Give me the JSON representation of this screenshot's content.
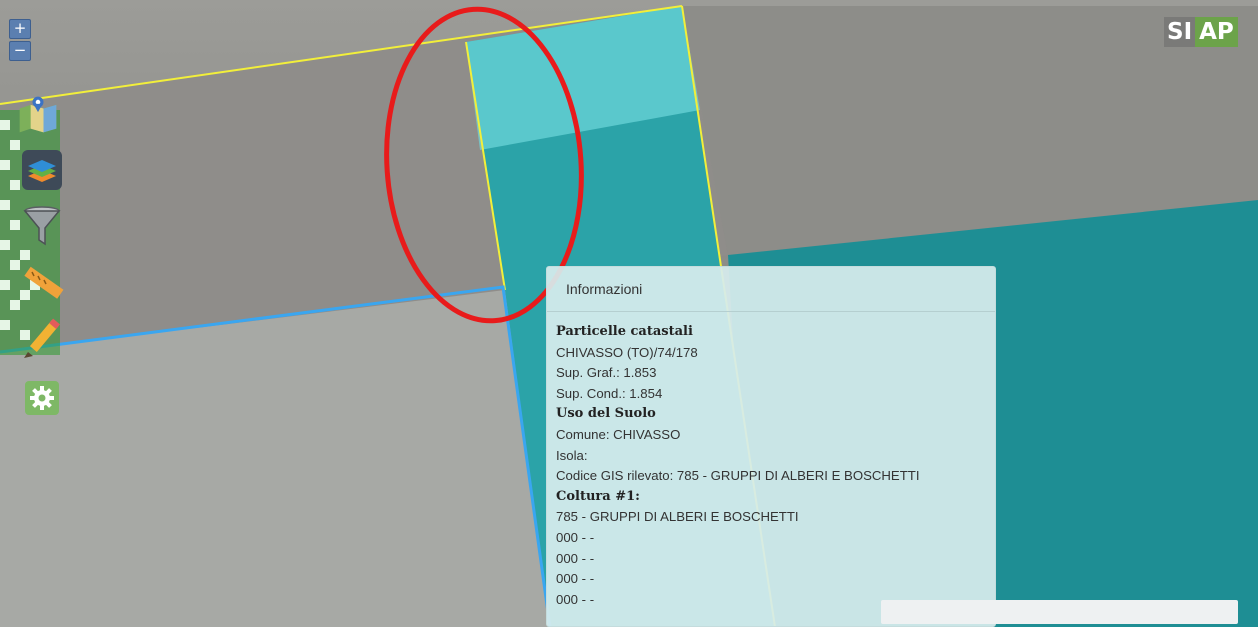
{
  "map": {
    "zoom_in_label": "+",
    "zoom_out_label": "−",
    "colors": {
      "parcel_teal": "#1f8f95",
      "parcel_border_yellow": "#f2ef3a",
      "parcel_border_blue": "#3aa6f0",
      "annotation_red": "#e81b1b"
    }
  },
  "logo": {
    "part1": "SI",
    "part2": "AP"
  },
  "toolbar": {
    "items": [
      {
        "icon": "map-pin-icon"
      },
      {
        "icon": "layers-icon"
      },
      {
        "icon": "filter-icon"
      },
      {
        "icon": "ruler-icon"
      },
      {
        "icon": "pencil-icon"
      },
      {
        "icon": "gear-icon"
      }
    ]
  },
  "info": {
    "title": "Informazioni",
    "section1": "Particelle catastali",
    "parcel": "CHIVASSO (TO)/74/178",
    "sup_graf": "Sup. Graf.: 1.853",
    "sup_cond": "Sup. Cond.: 1.854",
    "section2": "Uso del Suolo",
    "comune": "Comune: CHIVASSO",
    "isola": "Isola:",
    "codice_gis": "Codice GIS rilevato: 785 - GRUPPI DI ALBERI E BOSCHETTI",
    "section3": "Coltura #1:",
    "coltura": "785 - GRUPPI DI ALBERI E BOSCHETTI",
    "row1": "000 - -",
    "row2": "000 - -",
    "row3": "000 - -",
    "row4": "000 - -"
  }
}
